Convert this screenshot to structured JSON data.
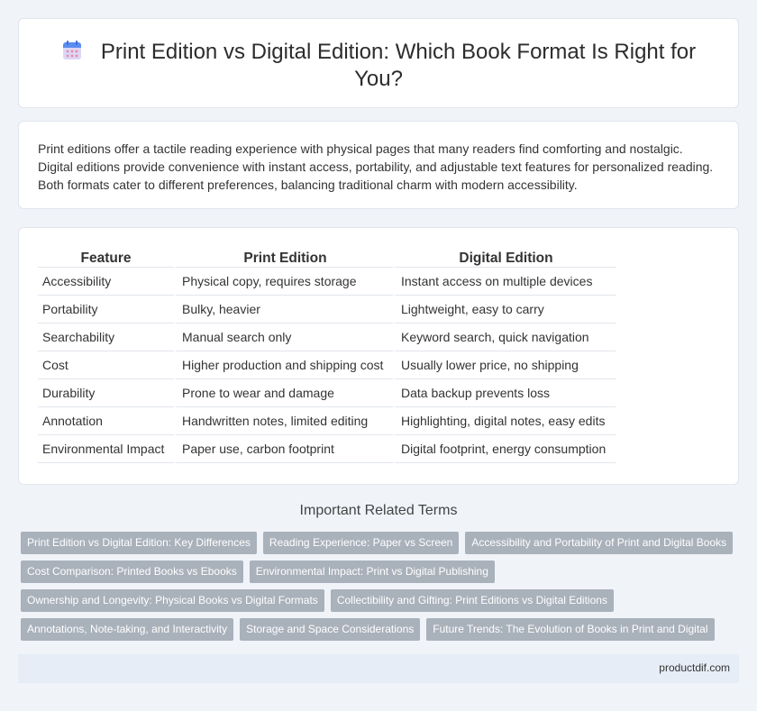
{
  "header": {
    "title": "Print Edition vs Digital Edition: Which Book Format Is Right for You?",
    "icon": "calendar-icon"
  },
  "intro": {
    "text": "Print editions offer a tactile reading experience with physical pages that many readers find comforting and nostalgic. Digital editions provide convenience with instant access, portability, and adjustable text features for personalized reading. Both formats cater to different preferences, balancing traditional charm with modern accessibility."
  },
  "table": {
    "headers": [
      "Feature",
      "Print Edition",
      "Digital Edition"
    ],
    "rows": [
      [
        "Accessibility",
        "Physical copy, requires storage",
        "Instant access on multiple devices"
      ],
      [
        "Portability",
        "Bulky, heavier",
        "Lightweight, easy to carry"
      ],
      [
        "Searchability",
        "Manual search only",
        "Keyword search, quick navigation"
      ],
      [
        "Cost",
        "Higher production and shipping cost",
        "Usually lower price, no shipping"
      ],
      [
        "Durability",
        "Prone to wear and damage",
        "Data backup prevents loss"
      ],
      [
        "Annotation",
        "Handwritten notes, limited editing",
        "Highlighting, digital notes, easy edits"
      ],
      [
        "Environmental Impact",
        "Paper use, carbon footprint",
        "Digital footprint, energy consumption"
      ]
    ]
  },
  "related": {
    "title": "Important Related Terms",
    "rows": [
      [
        "Print Edition vs Digital Edition: Key Differences",
        "Reading Experience: Paper vs Screen",
        "Accessibility and Portability of Print and Digital Books"
      ],
      [
        "Cost Comparison: Printed Books vs Ebooks",
        "Environmental Impact: Print vs Digital Publishing"
      ],
      [
        "Ownership and Longevity: Physical Books vs Digital Formats",
        "Collectibility and Gifting: Print Editions vs Digital Editions"
      ],
      [
        "Annotations, Note-taking, and Interactivity",
        "Storage and Space Considerations",
        "Future Trends: The Evolution of Books in Print and Digital"
      ]
    ]
  },
  "footer": {
    "site": "productdif.com"
  },
  "colors": {
    "background": "#f0f3f8",
    "tag": "#a9b1bb",
    "footer": "#e6edf7"
  }
}
